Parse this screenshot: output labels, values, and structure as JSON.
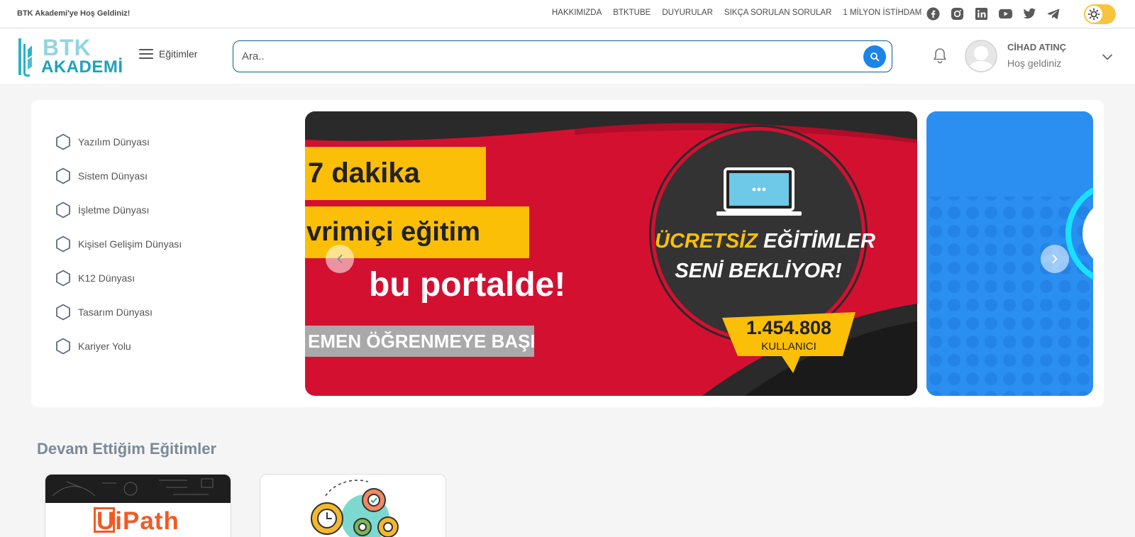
{
  "topbar": {
    "welcome": "BTK Akademi'ye Hoş Geldiniz!",
    "links": [
      "HAKKIMIZDA",
      "BTKTUBE",
      "DUYURULAR",
      "SIKÇA SORULAN SORULAR",
      "1 MİLYON İSTİHDAM"
    ],
    "social_icons": [
      "facebook-icon",
      "instagram-icon",
      "linkedin-icon",
      "youtube-icon",
      "twitter-icon",
      "telegram-icon"
    ],
    "theme_toggle_color": "#f8c43b"
  },
  "header": {
    "logo_top": "BTK",
    "logo_bottom": "AKADEMİ",
    "menu_label": "Eğitimler",
    "search_placeholder": "Ara..",
    "user_name": "CİHAD ATINÇ",
    "user_greeting": "Hoş geldiniz"
  },
  "categories": [
    "Yazılım Dünyası",
    "Sistem Dünyası",
    "İşletme Dünyası",
    "Kişisel Gelişim Dünyası",
    "K12 Dünyası",
    "Tasarım Dünyası",
    "Kariyer Yolu"
  ],
  "carousel": {
    "slide1": {
      "line1": "7 dakika",
      "line2": "vrimiçi eğitim",
      "line3": "bu portalde!",
      "line4": "EMEN ÖĞRENMEYE BAŞLA",
      "badge_free": "ÜCRETSİZ",
      "badge_rest": "EĞİTİMLER",
      "badge_line2": "SENİ BEKLİYOR!",
      "users_count": "1.454.808",
      "users_label": "KULLANICI"
    },
    "accent_red": "#d41031",
    "accent_yellow": "#fbbf08",
    "accent_blue": "#2a8ff0"
  },
  "continuing": {
    "title": "Devam Ettiğim Eğitimler",
    "course1_logo": "UiPath"
  },
  "colors": {
    "brand_teal": "#2bb3c6",
    "search_button": "#1b84e7"
  }
}
